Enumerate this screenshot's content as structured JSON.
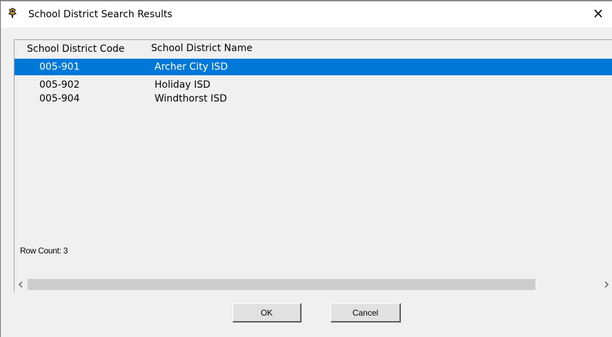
{
  "window": {
    "title": "School District Search Results",
    "close_glyph": "×",
    "app_icon": "app-icon"
  },
  "list": {
    "columns": [
      "School District Code",
      "School District Name"
    ],
    "rows": [
      {
        "code": "005-901",
        "name": "Archer City ISD",
        "selected": true
      },
      {
        "code": "005-902",
        "name": "Holiday ISD",
        "selected": false
      },
      {
        "code": "005-904",
        "name": "Windthorst ISD",
        "selected": false
      }
    ],
    "row_count_label": "Row Count: 3"
  },
  "scrollbar": {
    "left_glyph": "‹",
    "right_glyph": "›"
  },
  "buttons": {
    "ok_label": "OK",
    "cancel_label": "Cancel"
  },
  "colors": {
    "selection": "#0078d7",
    "selection_text": "#ffffff",
    "dialog_bg": "#f0f0f0"
  }
}
